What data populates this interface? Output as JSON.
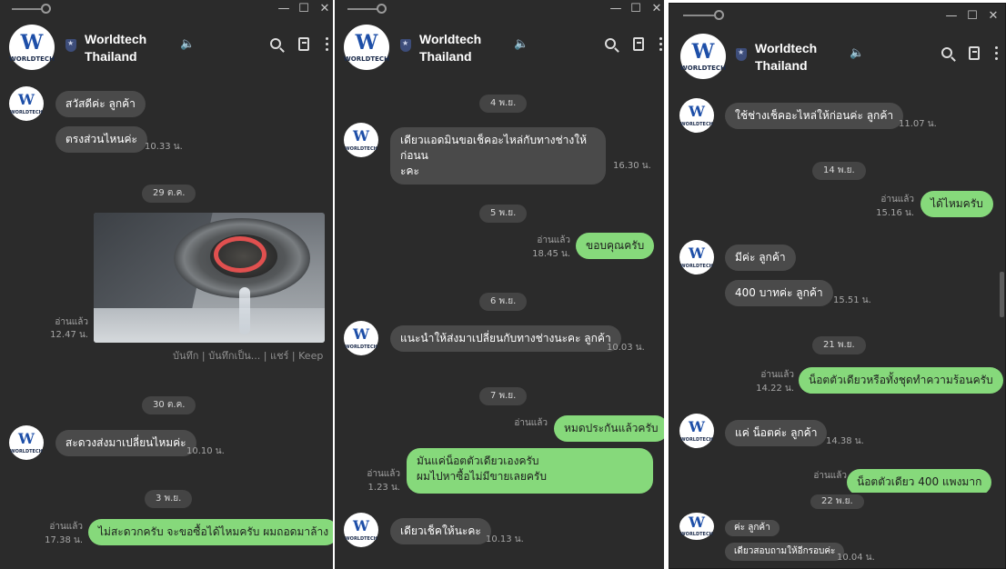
{
  "windows": [
    {
      "name": "Worldtech\nThailand",
      "line1": "Worldtech",
      "line2": "Thailand",
      "logo_text": "WORLDTECH",
      "messages": {
        "m1": "สวัสดีค่ะ ลูกค้า",
        "m2": "ตรงส่วนไหนค่ะ",
        "t1": "10.33 น.",
        "d1": "29 ต.ค.",
        "read1": "อ่านแล้ว",
        "t2": "12.47 น.",
        "actions": "บันทึก | บันทึกเป็น... | แชร์ | Keep",
        "d2": "30 ต.ค.",
        "m3": "สะดวงส่งมาเปลี่ยนไหมค่ะ",
        "t3": "10.10 น.",
        "d3": "3 พ.ย.",
        "read2": "อ่านแล้ว",
        "t4": "17.38 น.",
        "m4": "ไม่สะดวกครับ จะขอซื้อได้ไหมครับ ผมถอดมาล้าง"
      }
    },
    {
      "line1": "Worldtech",
      "line2": "Thailand",
      "logo_text": "WORLDTECH",
      "messages": {
        "d1": "4 พ.ย.",
        "m1a": "เดียวแอดมินขอเช็คอะไหล่กับทางช่างให้ก่อนน",
        "m1b": "ะคะ",
        "t1": "16.30 น.",
        "d2": "5 พ.ย.",
        "read1": "อ่านแล้ว",
        "t2": "18.45 น.",
        "m2": "ขอบคุณครับ",
        "d3": "6 พ.ย.",
        "m3": "แนะนำให้ส่งมาเปลี่ยนกับทางช่างนะคะ ลูกค้า",
        "t3": "10.03 น.",
        "d4": "7 พ.ย.",
        "read2": "อ่านแล้ว",
        "m4": "หมดประกันแล้วครับ",
        "read3": "อ่านแล้ว",
        "t4": "1.23 น.",
        "m5a": "มันแค่น็อตตัวเดียวเองครับ",
        "m5b": "ผมไปหาซื้อไม่มีขายเลยครับ",
        "m6": "เดียวเช็คให้นะคะ",
        "t5": "10.13 น."
      }
    },
    {
      "line1": "Worldtech",
      "line2": "Thailand",
      "logo_text": "WORLDTECH",
      "messages": {
        "m1": "ใช้ช่างเช็คอะไหล่ให้ก่อนค่ะ ลูกค้า",
        "t1": "11.07 น.",
        "d1": "14 พ.ย.",
        "read1": "อ่านแล้ว",
        "t2": "15.16 น.",
        "m2": "ได้ไหมครับ",
        "m3": "มีค่ะ ลูกค้า",
        "m4": "400 บาทค่ะ ลูกค้า",
        "t3": "15.51 น.",
        "d2": "21 พ.ย.",
        "read2": "อ่านแล้ว",
        "t4": "14.22 น.",
        "m5": "น็อตตัวเดียวหรือทั้งชุดทำความร้อนครับ",
        "m6": "แค่ น็อตค่ะ ลูกค้า",
        "t5": "14.38 น.",
        "read3": "อ่านแล้ว",
        "m7": "น็อตตัวเดียว 400 แพงมาก",
        "d3": "22 พ.ย.",
        "m8": "ค่ะ ลูกค้า",
        "m9": "เดียวสอบถามให้อีกรอบค่ะ",
        "t6": "10.04 น."
      }
    }
  ],
  "icons": {
    "minimize": "—",
    "maximize": "☐",
    "close": "✕",
    "speaker": "🔈"
  },
  "colors": {
    "background": "#2b2b2b",
    "incoming_bubble": "#4a4a4a",
    "outgoing_bubble": "#86d97b"
  }
}
